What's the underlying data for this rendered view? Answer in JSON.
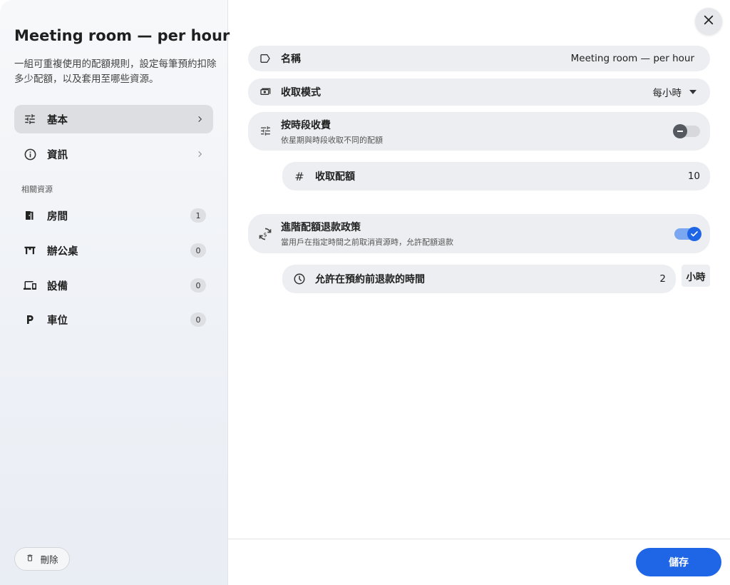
{
  "sidebar": {
    "title": "Meeting room — per hour",
    "description": "一組可重複使用的配額規則，設定每筆預約扣除多少配額，以及套用至哪些資源。",
    "nav": [
      {
        "label": "基本",
        "icon": "tune-icon",
        "active": true
      },
      {
        "label": "資訊",
        "icon": "info-icon",
        "active": false
      }
    ],
    "section_label": "相關資源",
    "resources": [
      {
        "label": "房間",
        "count": "1",
        "icon": "door-icon"
      },
      {
        "label": "辦公桌",
        "count": "0",
        "icon": "desk-icon"
      },
      {
        "label": "設備",
        "count": "0",
        "icon": "devices-icon"
      },
      {
        "label": "車位",
        "count": "0",
        "icon": "parking-icon"
      }
    ],
    "delete_label": "刪除"
  },
  "main": {
    "name_label": "名稱",
    "name_value": "Meeting room — per hour",
    "mode_label": "收取模式",
    "mode_value": "每小時",
    "timeslot_label": "按時段收費",
    "timeslot_sub": "依星期與時段收取不同的配額",
    "timeslot_enabled": false,
    "quota_label": "收取配額",
    "quota_value": "10",
    "refund_label": "進階配額退款政策",
    "refund_sub": "當用戶在指定時間之前取消資源時，允許配額退款",
    "refund_enabled": true,
    "refund_time_label": "允許在預約前退款的時間",
    "refund_time_value": "2",
    "refund_time_unit": "小時"
  },
  "footer": {
    "save_label": "儲存"
  },
  "colors": {
    "accent": "#1f66e6",
    "row_bg": "#eceef1"
  }
}
